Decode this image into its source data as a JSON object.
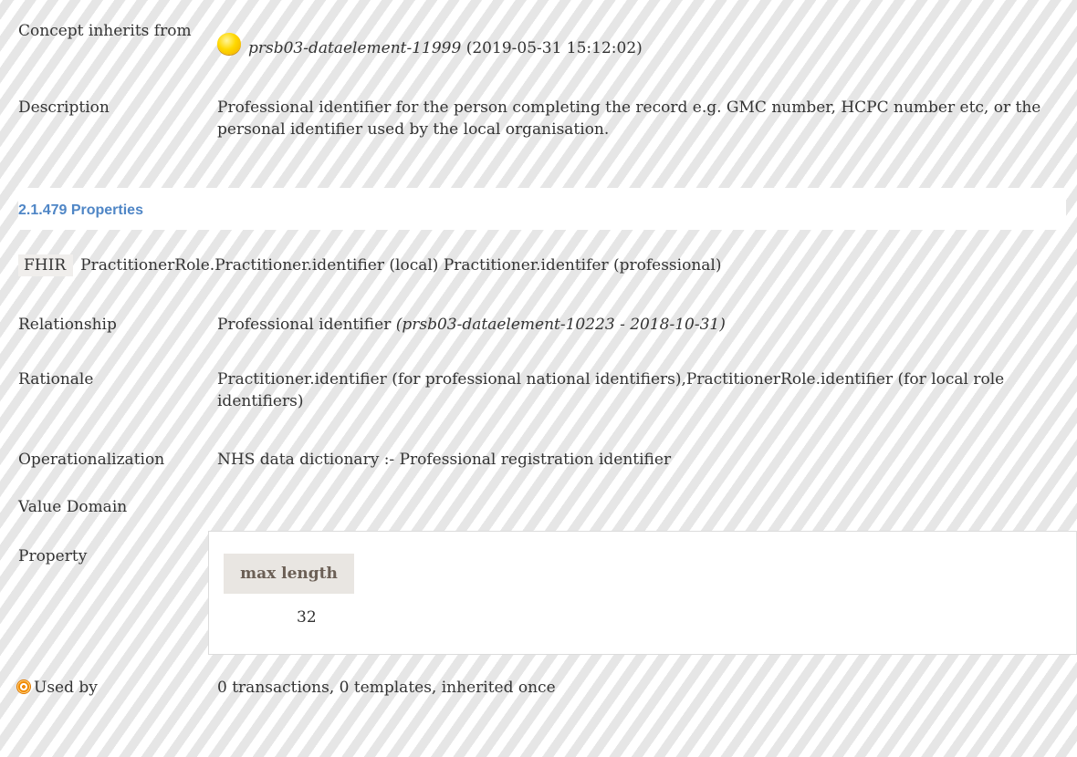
{
  "concept": {
    "inherits_label": "Concept inherits from",
    "inherits_ref": "prsb03-dataelement-11999",
    "inherits_date": "(2019-05-31 15:12:02)",
    "description_label": "Description",
    "description": "Professional identifier for the person completing the record e.g. GMC number, HCPC number etc, or the personal identifier used by the local organisation."
  },
  "properties": {
    "title": "2.1.479 Properties",
    "fhir_tag": "FHIR",
    "fhir_value": "PractitionerRole.Practitioner.identifier (local) Practitioner.identifer (professional)",
    "relationship_label": "Relationship",
    "relationship_text": "Professional identifier",
    "relationship_ref": "(prsb03-dataelement-10223 - 2018-10-31)",
    "rationale_label": "Rationale",
    "rationale": "Practitioner.identifier (for professional national identifiers),PractitionerRole.identifier (for local role identifiers)",
    "operationalization_label": "Operationalization",
    "operationalization": "NHS data dictionary :- Professional registration identifier",
    "value_domain_label": "Value Domain",
    "property_label": "Property",
    "max_length_label": "max length",
    "max_length_value": "32",
    "used_by_label": "Used by",
    "used_by": "0 transactions, 0 templates, inherited once"
  },
  "icons": {
    "inherit": "yellow-orb-icon",
    "used_by": "target-icon"
  },
  "colors": {
    "section_title": "#4f86c6"
  }
}
